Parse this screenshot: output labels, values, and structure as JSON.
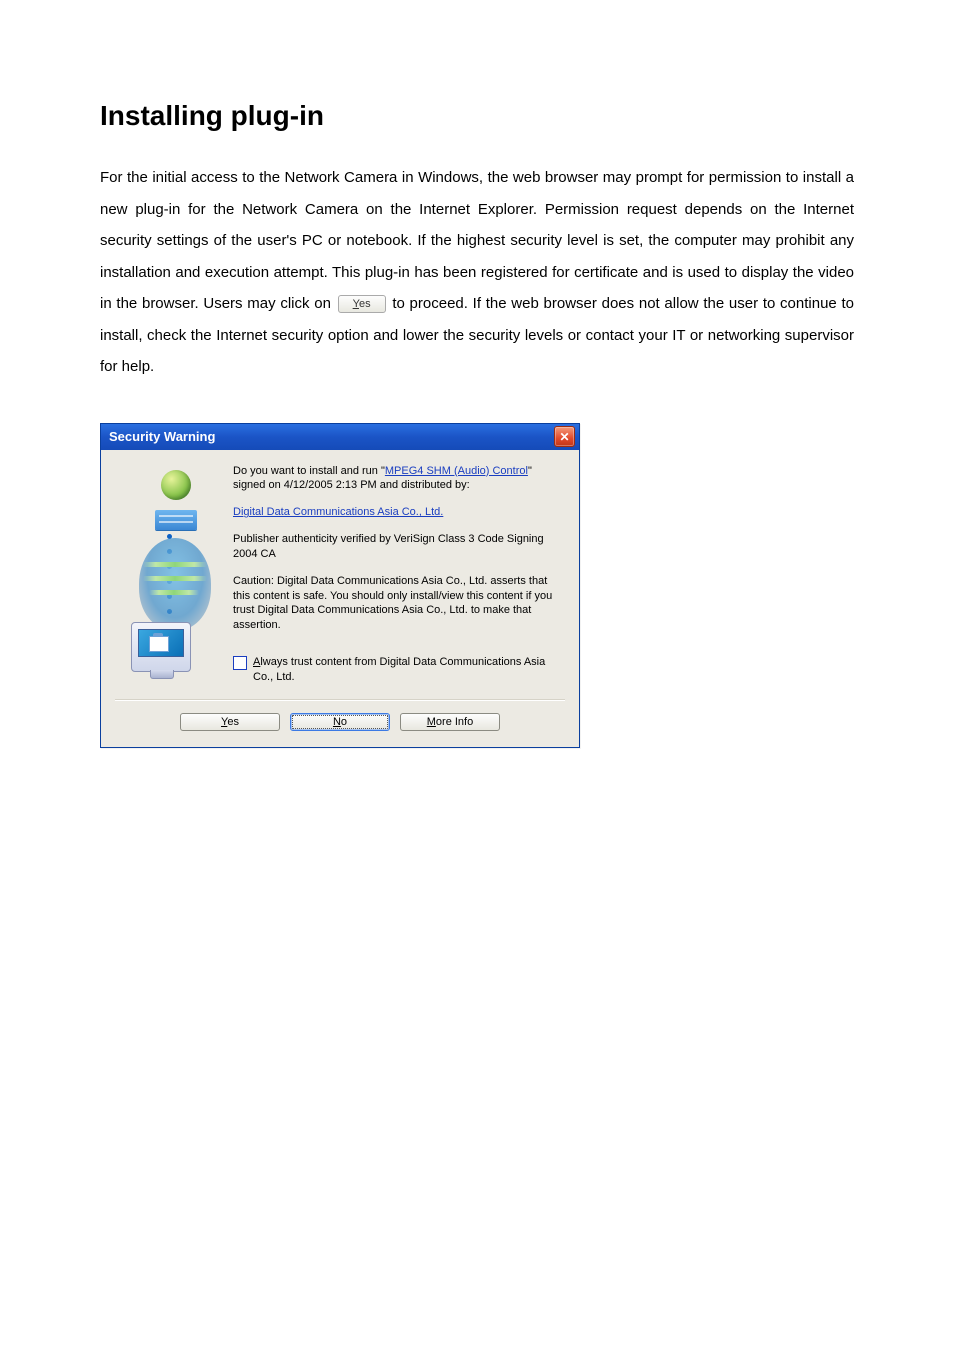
{
  "page": {
    "heading": "Installing plug-in",
    "body_before_btn": "For the initial access to the Network Camera in Windows, the web browser may prompt for permission to install a new plug-in for the Network Camera on the Internet Explorer. Permission request depends on the Internet security settings of the user's PC or notebook. If the highest security level is set, the computer may prohibit any installation and execution attempt. This plug-in has been registered for certificate and is used to display the video in the browser. Users may click on ",
    "inline_button_ukey": "Y",
    "inline_button_rest": "es",
    "body_after_btn": " to proceed. If the web browser does not allow the user to continue to install, check the Internet security option and lower the security levels or contact your IT or networking supervisor for help."
  },
  "dialog": {
    "title": "Security Warning",
    "close_glyph": "✕",
    "line1_pre": "Do you want to install and run \"",
    "line1_link": "MPEG4 SHM (Audio) Control",
    "line1_post": "\" signed on 4/12/2005 2:13 PM and distributed by:",
    "publisher_link": "Digital Data Communications Asia Co., Ltd.",
    "authenticity": "Publisher authenticity verified by VeriSign Class 3 Code Signing 2004 CA",
    "caution": "Caution: Digital Data Communications Asia Co., Ltd. asserts that this content is safe.  You should only install/view this content if you trust Digital Data Communications Asia Co., Ltd. to make that assertion.",
    "always_trust_ukey": "A",
    "always_trust_rest": "lways trust content from Digital Data Communications Asia Co., Ltd.",
    "buttons": {
      "yes_ukey": "Y",
      "yes_rest": "es",
      "no_ukey": "N",
      "no_rest": "o",
      "more_ukey": "M",
      "more_rest": "ore Info"
    }
  }
}
